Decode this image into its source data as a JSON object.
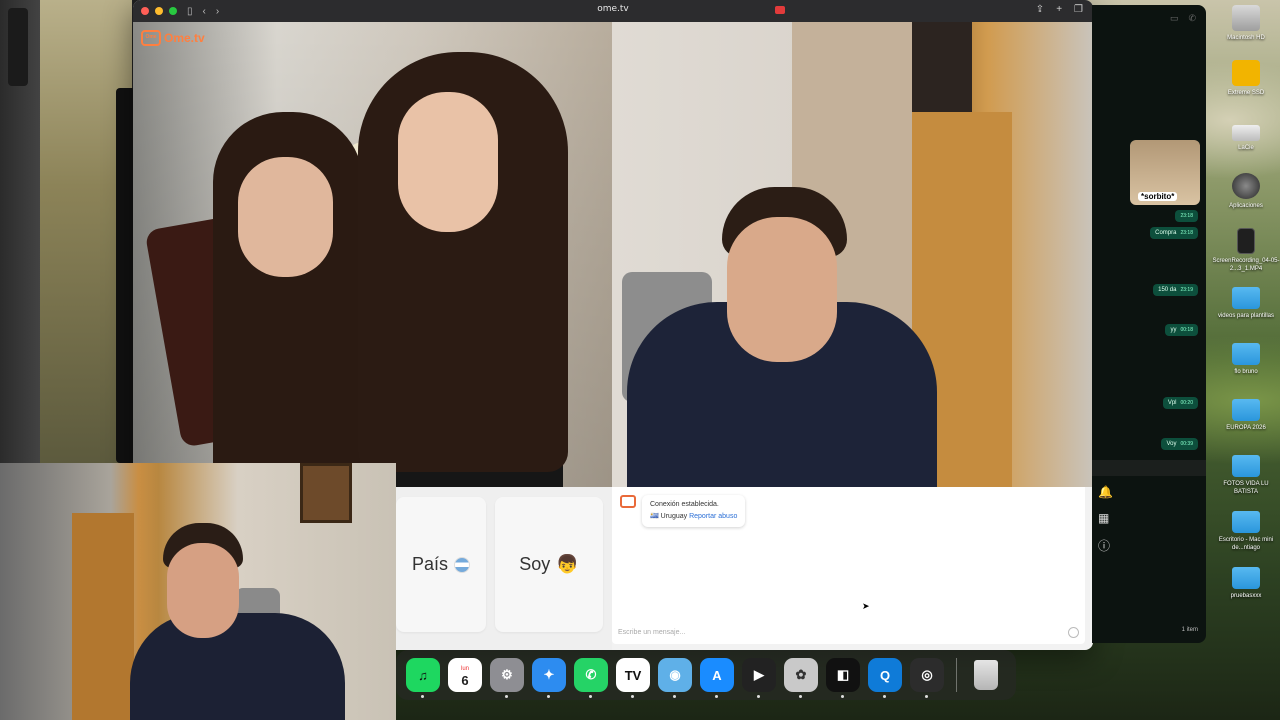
{
  "browser": {
    "url": "ome.tv",
    "logo_text": "Ome.tv",
    "logo_box_text": "Ome"
  },
  "controls": {
    "country_label": "País",
    "gender_label": "Soy"
  },
  "chat": {
    "status_line": "Conexión establecida.",
    "country": "Uruguay",
    "report_link": "Reportar abuso",
    "input_placeholder": "Escribe un mensaje..."
  },
  "whatsapp": {
    "sticker_label": "*sorbito*",
    "messages": [
      {
        "text": "",
        "time": "23:18"
      },
      {
        "text": "Compra",
        "time": "23:18"
      },
      {
        "text": "150 da",
        "time": "23:19"
      },
      {
        "text": "yy",
        "time": "00:18"
      },
      {
        "text": "Vpl",
        "time": "00:20"
      },
      {
        "text": "Voy",
        "time": "00:39"
      }
    ],
    "footer": "1 item"
  },
  "desktop_icons": [
    {
      "label": "Macintosh HD",
      "type": "hd"
    },
    {
      "label": "Extreme SSD",
      "type": "ssd"
    },
    {
      "label": "LaCie",
      "type": "lacie"
    },
    {
      "label": "Aplicaciones",
      "type": "apps"
    },
    {
      "label": "ScreenRecording_04-05-2...3_1.MP4",
      "type": "file"
    },
    {
      "label": "videos para plantillas",
      "type": "folder"
    },
    {
      "label": "flo bruno",
      "type": "folder"
    },
    {
      "label": "EUROPA 2026",
      "type": "folder"
    },
    {
      "label": "FOTOS VIDA LU BATISTA",
      "type": "folder"
    },
    {
      "label": "Escritorio - Mac mini de...ntiago",
      "type": "folder"
    },
    {
      "label": "pruebasxxx",
      "type": "folder"
    }
  ],
  "dock": {
    "calendar_month": "lun",
    "calendar_day": "6",
    "apps": [
      "spotify-icon",
      "calendar-icon",
      "settings-icon",
      "safari-icon",
      "whatsapp-icon",
      "tradingview-icon",
      "preview-icon",
      "app-store-icon",
      "final-cut-icon",
      "compressor-icon",
      "capcut-icon",
      "quicktime-icon",
      "screen-recorder-icon",
      "trash-icon"
    ]
  },
  "colors": {
    "ome_accent": "#ff7f3f",
    "link_blue": "#2b6fd6",
    "wa_bubble": "#0d4f3c"
  }
}
